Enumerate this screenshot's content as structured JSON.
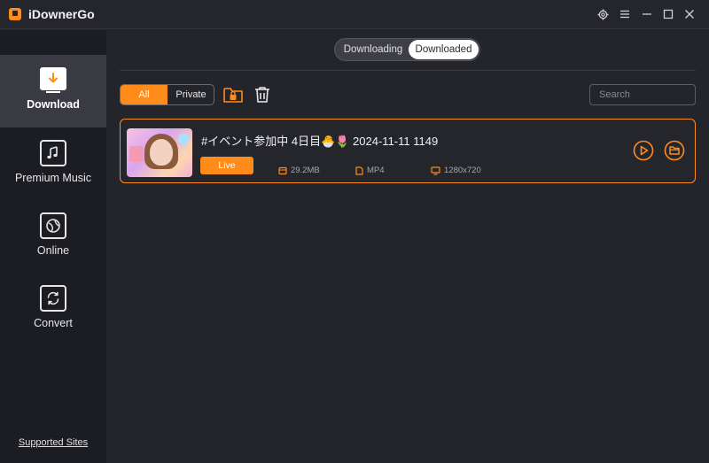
{
  "app": {
    "title": "iDownerGo"
  },
  "sidebar": {
    "items": [
      {
        "label": "Download",
        "icon": "download-icon",
        "active": true
      },
      {
        "label": "Premium Music",
        "icon": "music-note-icon",
        "active": false
      },
      {
        "label": "Online",
        "icon": "globe-icon",
        "active": false
      },
      {
        "label": "Convert",
        "icon": "convert-icon",
        "active": false
      }
    ],
    "footer_link": "Supported Sites"
  },
  "tabs": [
    {
      "label": "Downloading",
      "selected": false
    },
    {
      "label": "Downloaded",
      "selected": true
    }
  ],
  "filter": {
    "all": "All",
    "private": "Private",
    "selected": "All"
  },
  "search": {
    "placeholder": "Search",
    "value": ""
  },
  "items": [
    {
      "title": "#イベント参加中 4日目🐣🌷 2024-11-11 1149",
      "badge": "Live",
      "size": "29.2MB",
      "format": "MP4",
      "resolution": "1280x720"
    }
  ],
  "colors": {
    "accent": "#ff8c1a",
    "background": "#24252b",
    "sidebar": "#1c1d22"
  }
}
